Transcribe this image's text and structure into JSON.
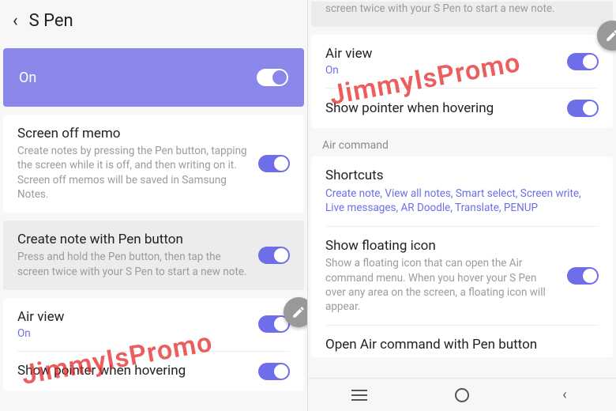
{
  "left": {
    "title": "S Pen",
    "on_label": "On",
    "items": [
      {
        "title": "Screen off memo",
        "desc": "Create notes by pressing the Pen button, tapping the screen while it is off, and then writing on it. Screen off memos will be saved in Samsung Notes."
      },
      {
        "title": "Create note with Pen button",
        "desc": "Press and hold the Pen button, then tap the screen twice with your S Pen to start a new note."
      },
      {
        "title": "Air view",
        "status": "On"
      },
      {
        "title": "Show pointer when hovering"
      }
    ],
    "watermark": "JimmyIsPromo"
  },
  "right": {
    "partial_desc_top": "screen twice with your S Pen to start a new note.",
    "air_view": {
      "title": "Air view",
      "status": "On"
    },
    "pointer": {
      "title": "Show pointer when hovering"
    },
    "section": "Air command",
    "shortcuts": {
      "title": "Shortcuts",
      "list": "Create note, View all notes, Smart select, Screen write, Live messages, AR Doodle, Translate, PENUP"
    },
    "floating": {
      "title": "Show floating icon",
      "desc": "Show a floating icon that can open the Air command menu. When you hover your S Pen over any area on the screen, a floating icon will appear."
    },
    "open_air": {
      "title": "Open Air command with Pen button"
    },
    "watermark": "JimmyIsPromo"
  }
}
